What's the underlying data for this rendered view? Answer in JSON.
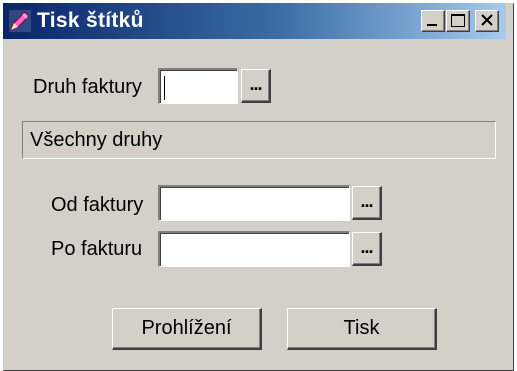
{
  "window": {
    "title": "Tisk štítků",
    "icon": "pencil-app-icon",
    "controls": {
      "minimize": "minimize-icon",
      "maximize": "maximize-icon",
      "close": "close-icon"
    }
  },
  "form": {
    "druh_faktury": {
      "label": "Druh faktury",
      "value": "",
      "button_label": "..."
    },
    "druh_description": "Všechny druhy",
    "od_faktury": {
      "label": "Od faktury",
      "value": "",
      "button_label": "..."
    },
    "po_fakturu": {
      "label": "Po fakturu",
      "value": "",
      "button_label": "..."
    }
  },
  "buttons": {
    "preview": "Prohlížení",
    "print": "Tisk"
  },
  "colors": {
    "face": "#d4d0c8",
    "title_start": "#0a246a",
    "title_end": "#a6caf0"
  }
}
